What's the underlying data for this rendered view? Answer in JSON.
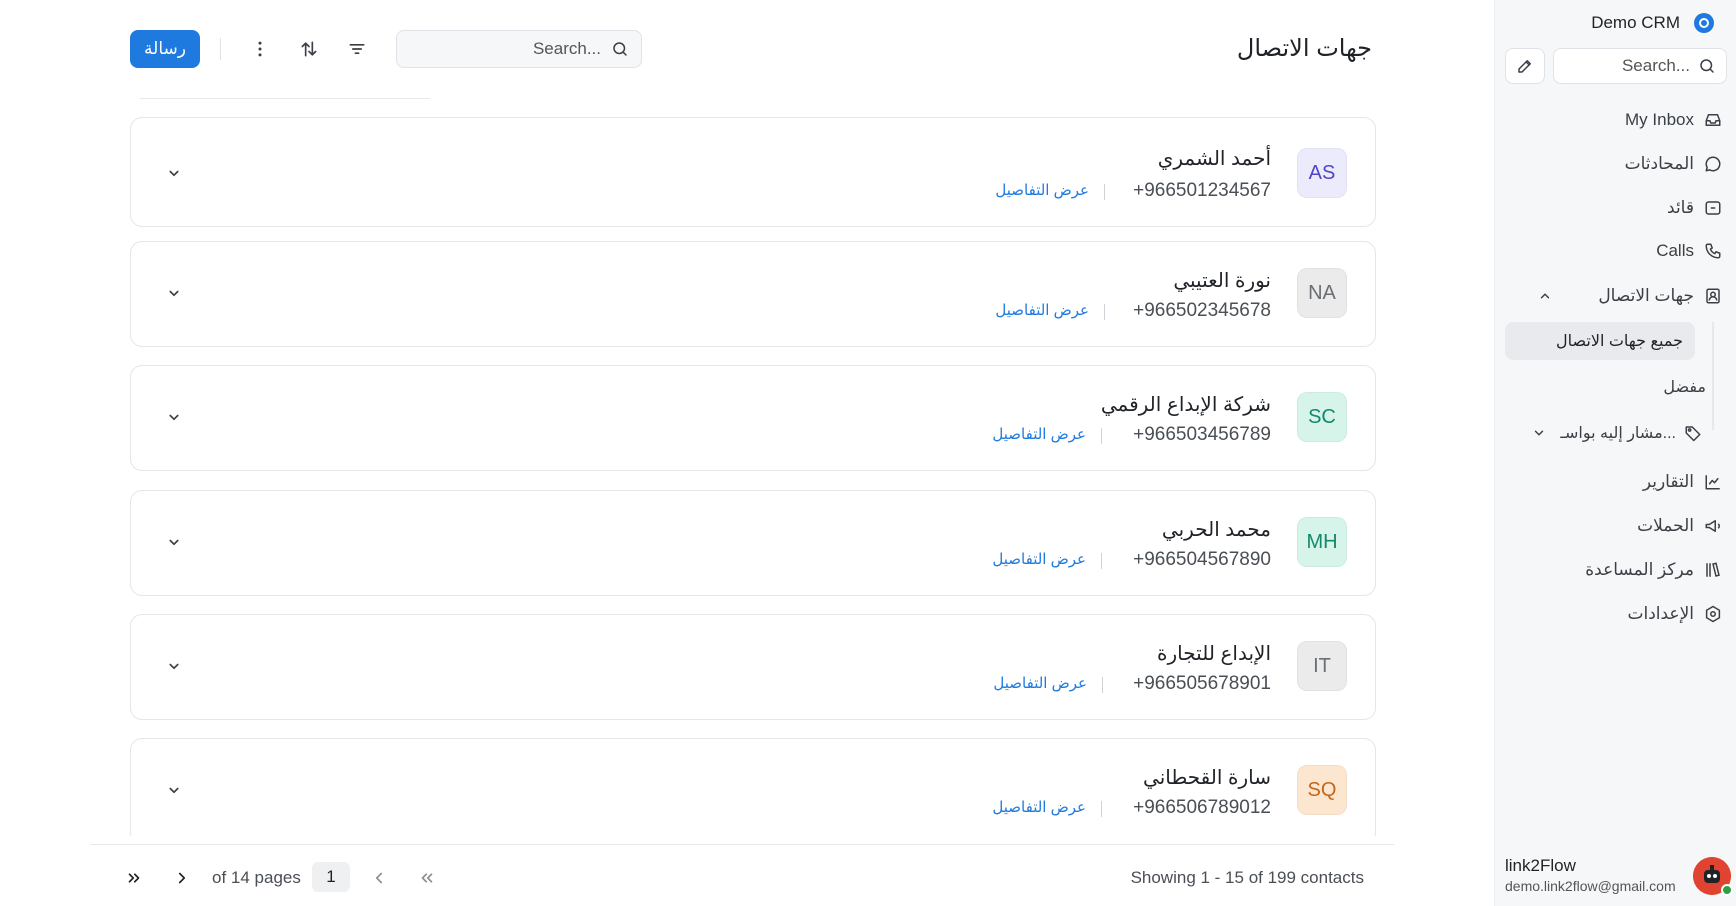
{
  "sidebar": {
    "brand": "Demo CRM",
    "search_placeholder": "Search...",
    "nav": [
      {
        "label": "My Inbox",
        "icon": "inbox-icon"
      },
      {
        "label": "المحادثات",
        "icon": "chat-bubble-icon"
      },
      {
        "label": "قائد",
        "icon": "lead-card-icon"
      },
      {
        "label": "Calls",
        "icon": "phone-icon"
      },
      {
        "label": "جهات الاتصال",
        "icon": "contact-book-icon"
      },
      {
        "label": "التقارير",
        "icon": "chart-icon"
      },
      {
        "label": "الحملات",
        "icon": "megaphone-icon"
      },
      {
        "label": "مركز المساعدة",
        "icon": "library-icon"
      },
      {
        "label": "الإعدادات",
        "icon": "settings-icon"
      }
    ],
    "contacts_sub": {
      "all": "جميع جهات الاتصال",
      "favorite": "مفضل",
      "tagged": "مشار إليه بواسـ..."
    },
    "user": {
      "name": "link2Flow",
      "email": "demo.link2flow@gmail.com"
    }
  },
  "header": {
    "title": "جهات الاتصال",
    "search_placeholder": "Search...",
    "message_button": "رسالة"
  },
  "contacts": [
    {
      "initials": "AS",
      "name": "أحمد الشمري",
      "phone": "+966501234567",
      "details": "عرض التفاصيل",
      "avatar_bg": "#ecebfb",
      "avatar_fg": "#4f46c8"
    },
    {
      "initials": "NA",
      "name": "نورة العتيبي",
      "phone": "+966502345678",
      "details": "عرض التفاصيل",
      "avatar_bg": "#ebebeb",
      "avatar_fg": "#6b6f75"
    },
    {
      "initials": "SC",
      "name": "شركة الإبداع الرقمي",
      "phone": "+966503456789",
      "details": "عرض التفاصيل",
      "avatar_bg": "#d6f4ea",
      "avatar_fg": "#13896a"
    },
    {
      "initials": "MH",
      "name": "محمد الحربي",
      "phone": "+966504567890",
      "details": "عرض التفاصيل",
      "avatar_bg": "#d6f4ea",
      "avatar_fg": "#13896a"
    },
    {
      "initials": "IT",
      "name": "الإبداع للتجارة",
      "phone": "+966505678901",
      "details": "عرض التفاصيل",
      "avatar_bg": "#ebebeb",
      "avatar_fg": "#6b6f75"
    },
    {
      "initials": "SQ",
      "name": "سارة القحطاني",
      "phone": "+966506789012",
      "details": "عرض التفاصيل",
      "avatar_bg": "#fde6cf",
      "avatar_fg": "#c2671b"
    }
  ],
  "pagination": {
    "current_page": "1",
    "of_pages": "of 14 pages",
    "showing": "Showing 1 - 15 of 199 contacts"
  },
  "colors": {
    "accent": "#1f7ae0",
    "sidebar_bg": "#f6f7f8"
  }
}
